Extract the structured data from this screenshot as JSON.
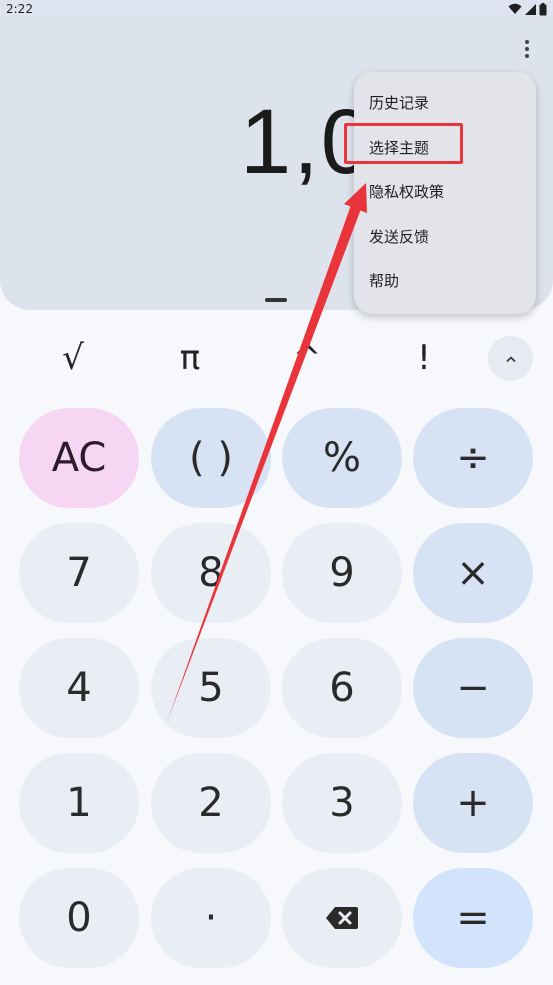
{
  "status_bar": {
    "time": "2:22"
  },
  "display": {
    "result": "1,0"
  },
  "scientific": {
    "sqrt": "√",
    "pi": "π",
    "power": "^",
    "factorial": "!"
  },
  "keypad": {
    "ac": "AC",
    "parens": "( )",
    "percent": "%",
    "divide": "÷",
    "seven": "7",
    "eight": "8",
    "nine": "9",
    "multiply": "×",
    "four": "4",
    "five": "5",
    "six": "6",
    "minus": "−",
    "one": "1",
    "two": "2",
    "three": "3",
    "plus": "+",
    "zero": "0",
    "decimal": "·",
    "equals": "="
  },
  "menu": {
    "items": [
      "历史记录",
      "选择主题",
      "隐私权政策",
      "发送反馈",
      "帮助"
    ],
    "highlighted": "选择主题"
  },
  "annotation": {
    "arrow_color": "#e8343a"
  }
}
